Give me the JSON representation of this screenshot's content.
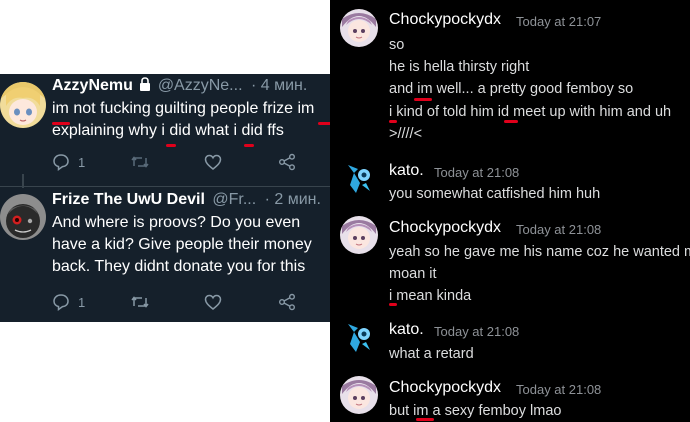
{
  "twitter": {
    "tweets": [
      {
        "display_name": "AzzyNemu",
        "handle": "@AzzyNe...",
        "time": "· 4 мин.",
        "lines": [
          "im not fucking guilting people frize im",
          "explaining why i did what i did ffs"
        ],
        "reply_count": "1",
        "retweet_count": "",
        "like_count": ""
      },
      {
        "display_name": "Frize The UwU Devil",
        "handle": "@Fr...",
        "time": "· 2 мин.",
        "lines": [
          "And where is proovs? Do you even",
          "have a kid? Give people their money",
          "back. They didnt donate you for this"
        ],
        "reply_count": "1",
        "retweet_count": "",
        "like_count": ""
      }
    ],
    "colors": {
      "background": "#15202b",
      "text": "#ffffff",
      "muted": "#8899a6"
    }
  },
  "discord": {
    "messages": [
      {
        "author": "Chockypockydx",
        "timestamp": "Today at 21:07",
        "lines": [
          "so",
          "he is hella thirsty right",
          "and im well... a pretty good femboy so",
          "i kind of told him id meet up with him and uh",
          ">////<"
        ]
      },
      {
        "author": "kato.",
        "timestamp": "Today at 21:08",
        "lines": [
          "you somewhat catfished him huh"
        ]
      },
      {
        "author": "Chockypockydx",
        "timestamp": "Today at 21:08",
        "lines": [
          "yeah so he gave me his name coz he wanted m",
          "moan it",
          "i mean kinda"
        ]
      },
      {
        "author": "kato.",
        "timestamp": "Today at 21:08",
        "lines": [
          "what a retard"
        ]
      },
      {
        "author": "Chockypockydx",
        "timestamp": "Today at 21:08",
        "lines": [
          "but im a sexy femboy lmao"
        ]
      }
    ],
    "colors": {
      "background": "#000000",
      "text": "#dcddde",
      "muted": "#8e9297",
      "annotation": "#e0001b"
    }
  }
}
